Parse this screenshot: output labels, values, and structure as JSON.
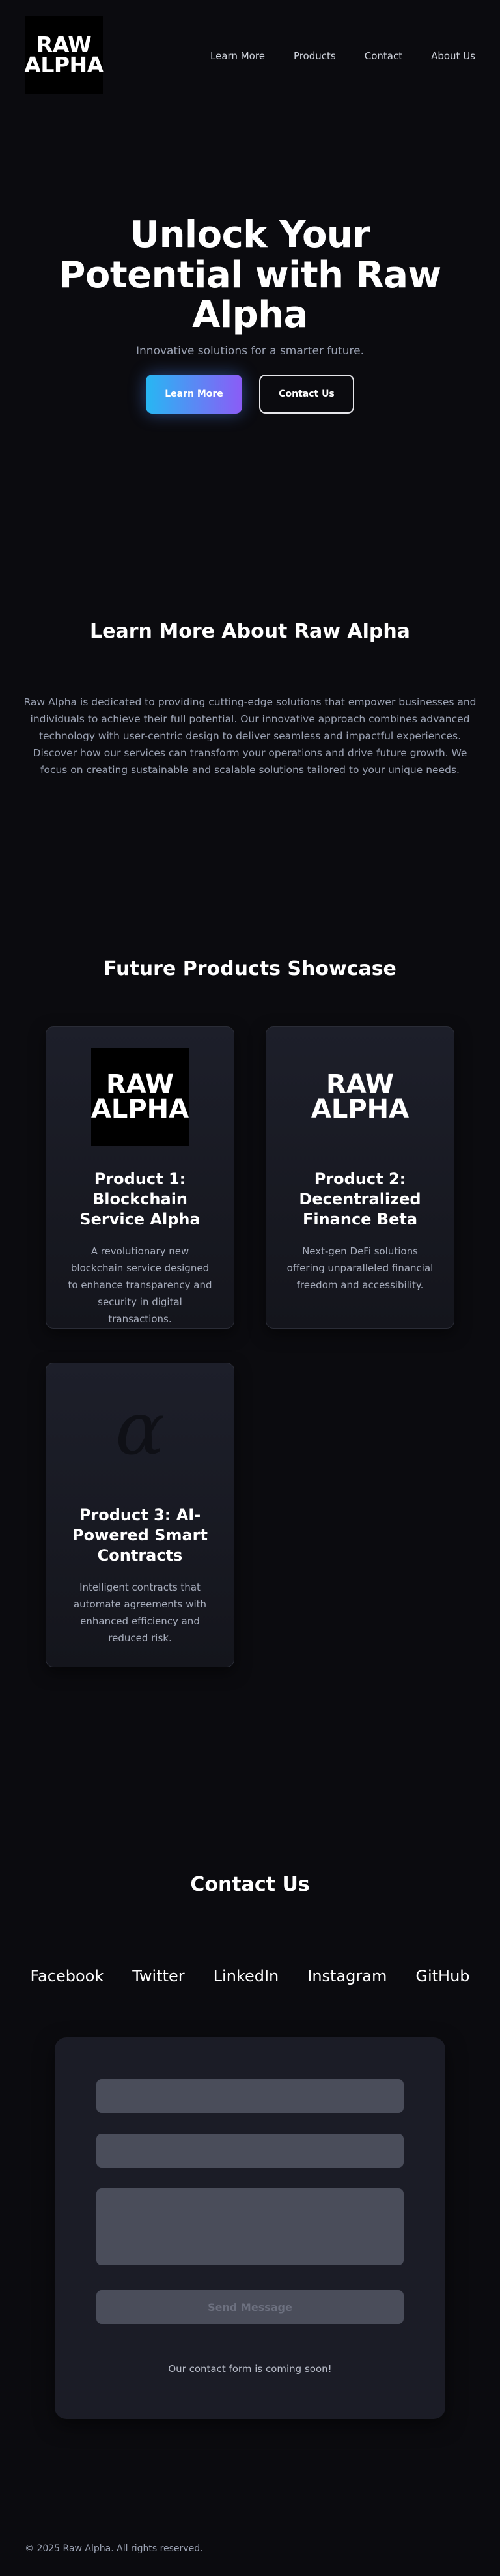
{
  "nav": {
    "logo_line1": "RAW",
    "logo_line2": "ALPHA",
    "links": [
      "Learn More",
      "Products",
      "Contact",
      "About Us"
    ]
  },
  "hero": {
    "title": "Unlock Your Potential with Raw Alpha",
    "subtitle": "Innovative solutions for a smarter future.",
    "primary_button": "Learn More",
    "secondary_button": "Contact Us"
  },
  "about": {
    "heading": "Learn More About Raw Alpha",
    "paragraph1": "Raw Alpha is dedicated to providing cutting-edge solutions that empower businesses and individuals to achieve their full potential. Our innovative approach combines advanced technology with user-centric design to deliver seamless and impactful experiences.",
    "paragraph2": "Discover how our services can transform your operations and drive future growth. We focus on creating sustainable and scalable solutions tailored to your unique needs."
  },
  "products": {
    "heading": "Future Products Showcase",
    "items": [
      {
        "title": "Product 1: Blockchain Service Alpha",
        "description": "A revolutionary new blockchain service designed to enhance transparency and security in digital transactions.",
        "logo_line1": "RAW",
        "logo_line2": "ALPHA"
      },
      {
        "title": "Product 2: Decentralized Finance Beta",
        "description": "Next-gen DeFi solutions offering unparalleled financial freedom and accessibility.",
        "logo_line1": "RAW",
        "logo_line2": "ALPHA"
      },
      {
        "title": "Product 3: AI-Powered Smart Contracts",
        "description": "Intelligent contracts that automate agreements with enhanced efficiency and reduced risk.",
        "icon": "alpha-symbol-icon"
      }
    ]
  },
  "contact": {
    "heading": "Contact Us",
    "socials": [
      "Facebook",
      "Twitter",
      "LinkedIn",
      "Instagram",
      "GitHub"
    ],
    "send_button": "Send Message",
    "note": "Our contact form is coming soon!"
  },
  "footer": {
    "text": "© 2025 Raw Alpha. All rights reserved."
  },
  "colors": {
    "background": "#0b0b0f",
    "card": "#1b1c26",
    "gradient_start": "#27b7f3",
    "gradient_end": "#8b5cf6"
  }
}
